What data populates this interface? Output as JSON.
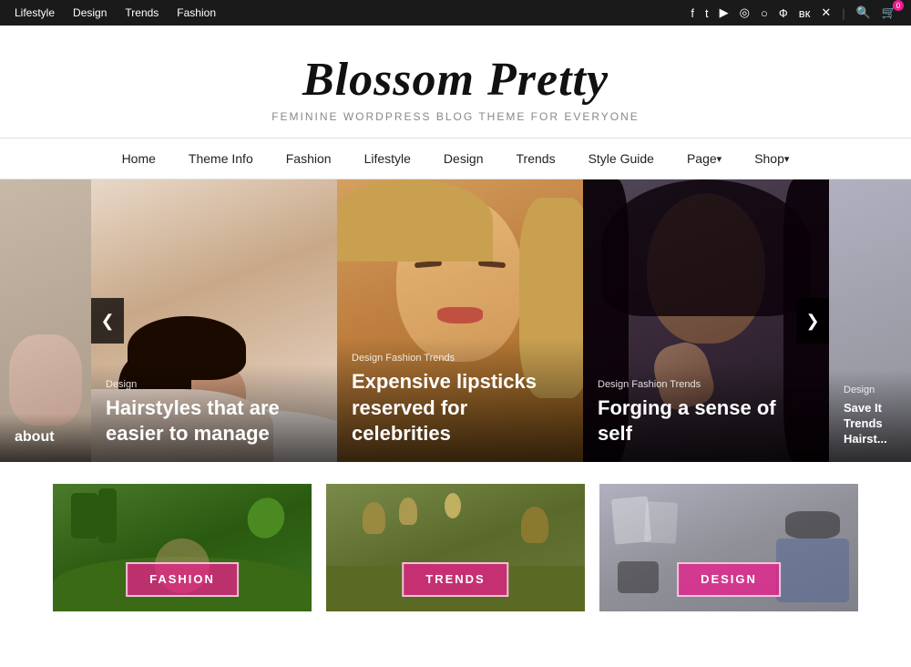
{
  "topBar": {
    "navItems": [
      {
        "label": "Lifestyle",
        "href": "#"
      },
      {
        "label": "Design",
        "href": "#"
      },
      {
        "label": "Trends",
        "href": "#"
      },
      {
        "label": "Fashion",
        "href": "#"
      }
    ],
    "icons": [
      "f",
      "t",
      "▶",
      "◉",
      "◎",
      "✿",
      "вк",
      "✕"
    ],
    "cartCount": "0"
  },
  "header": {
    "title": "Blossom Pretty",
    "subtitle": "Feminine WordPress Blog Theme For Everyone"
  },
  "mainNav": [
    {
      "label": "Home",
      "href": "#",
      "hasArrow": false
    },
    {
      "label": "Theme Info",
      "href": "#",
      "hasArrow": false
    },
    {
      "label": "Fashion",
      "href": "#",
      "hasArrow": false
    },
    {
      "label": "Lifestyle",
      "href": "#",
      "hasArrow": false
    },
    {
      "label": "Design",
      "href": "#",
      "hasArrow": false
    },
    {
      "label": "Trends",
      "href": "#",
      "hasArrow": false
    },
    {
      "label": "Style Guide",
      "href": "#",
      "hasArrow": false
    },
    {
      "label": "Page",
      "href": "#",
      "hasArrow": true
    },
    {
      "label": "Shop",
      "href": "#",
      "hasArrow": true
    }
  ],
  "slider": {
    "prevArrow": "❮",
    "nextArrow": "❯",
    "slides": [
      {
        "category": "",
        "title": "About",
        "bgClass": "bg-slide1"
      },
      {
        "category": "Design",
        "title": "Hairstyles that are easier to manage",
        "bgClass": "bg-slide2"
      },
      {
        "category": "Design Fashion Trends",
        "title": "Expensive lipsticks reserved for celebrities",
        "bgClass": "bg-slide3"
      },
      {
        "category": "Design Fashion Trends",
        "title": "Forging a sense of self",
        "bgClass": "bg-slide4"
      },
      {
        "category": "Design",
        "title": "Save It Trends Hairst...",
        "bgClass": "bg-slide5"
      }
    ]
  },
  "bottomGrid": [
    {
      "label": "FASHION",
      "bgClass": "bg-garden"
    },
    {
      "label": "TRENDS",
      "bgClass": "bg-flowers"
    },
    {
      "label": "DESIGN",
      "bgClass": "bg-desk"
    }
  ]
}
